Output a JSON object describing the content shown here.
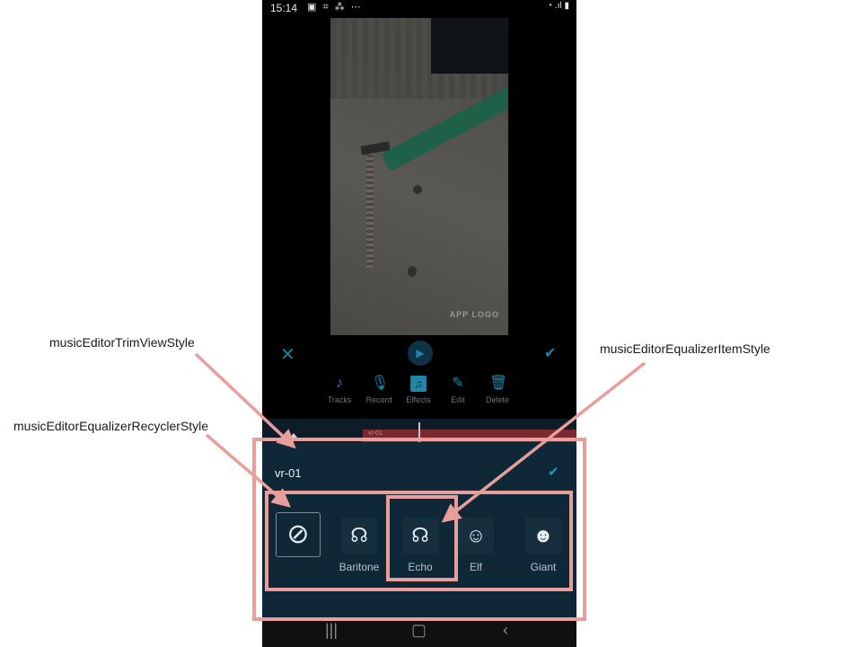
{
  "status_bar": {
    "time": "15:14",
    "left_icons": "▣ ⌗ ⁂ ⋯",
    "right_icons": "◔ .ıl ▮"
  },
  "video": {
    "watermark": "APP LOGO"
  },
  "controls": {
    "close_icon": "close-icon",
    "play_icon": "play-icon",
    "confirm_icon": "check-icon"
  },
  "toolbar": {
    "items": [
      {
        "label": "Tracks",
        "icon": "music-note-icon"
      },
      {
        "label": "Record",
        "icon": "microphone-icon"
      },
      {
        "label": "Effects",
        "icon": "effects-icon"
      },
      {
        "label": "Edit",
        "icon": "pencil-icon"
      },
      {
        "label": "Delete",
        "icon": "trash-icon"
      }
    ]
  },
  "timeline": {
    "clip_label": "vr-01"
  },
  "panel": {
    "title": "vr-01",
    "items": [
      {
        "label": "",
        "icon": "none-icon"
      },
      {
        "label": "Baritone",
        "icon": "baritone-icon"
      },
      {
        "label": "Echo",
        "icon": "echo-icon"
      },
      {
        "label": "Elf",
        "icon": "elf-icon"
      },
      {
        "label": "Giant",
        "icon": "giant-icon"
      }
    ]
  },
  "annotations": {
    "trim_view": "musicEditorTrimViewStyle",
    "recycler": "musicEditorEqualizerRecyclerStyle",
    "item": "musicEditorEqualizerItemStyle"
  },
  "colors": {
    "annotation": "#e99e9b",
    "accent": "#1f86a8",
    "panel_bg": "#0e2838"
  }
}
